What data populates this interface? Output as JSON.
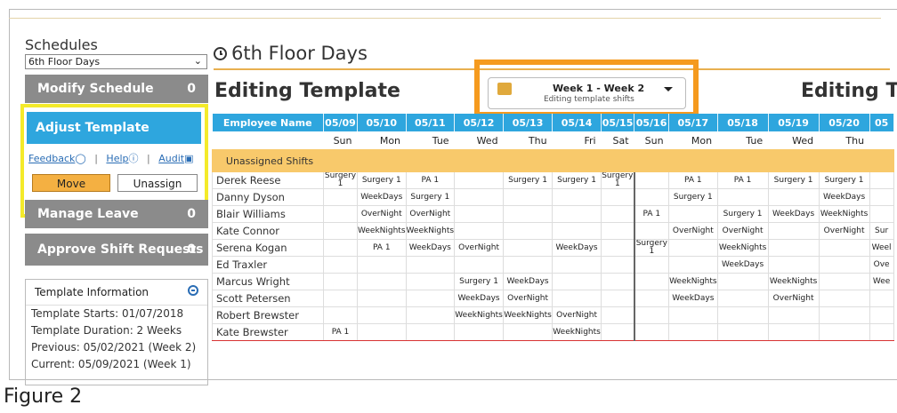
{
  "sidebar": {
    "title": "Schedules",
    "schedule_select": "6th Floor Days",
    "modify": {
      "label": "Modify Schedule",
      "count": "0"
    },
    "adjust": {
      "label": "Adjust Template"
    },
    "links": {
      "feedback": "Feedback",
      "help": "Help",
      "audit": "Audit"
    },
    "move_label": "Move",
    "unassign_label": "Unassign",
    "manage": {
      "label": "Manage Leave",
      "count": "0"
    },
    "approve": {
      "label": "Approve Shift Requests",
      "count": "0"
    },
    "info": {
      "title": "Template Information",
      "rows": [
        "Template Starts: 01/07/2018",
        "Template Duration: 2 Weeks",
        "Previous: 05/02/2021 (Week 2)",
        "Current: 05/09/2021 (Week 1)"
      ]
    }
  },
  "main": {
    "title": "6th Floor Days",
    "editing_left": "Editing Template",
    "editing_right": "Editing Te",
    "week_selector": {
      "label": "Week 1 - Week 2",
      "sub": "Editing template shifts"
    }
  },
  "grid": {
    "name_header": "Employee Name",
    "dates": [
      "05/09",
      "05/10",
      "05/11",
      "05/12",
      "05/13",
      "05/14",
      "05/15",
      "05/16",
      "05/17",
      "05/18",
      "05/19",
      "05/20",
      "05"
    ],
    "days": [
      "Sun",
      "Mon",
      "Tue",
      "Wed",
      "Thu",
      "Fri",
      "Sat",
      "Sun",
      "Mon",
      "Tue",
      "Wed",
      "Thu",
      ""
    ],
    "unassigned_label": "Unassigned Shifts",
    "rows": [
      {
        "name": "Derek Reese",
        "cells": [
          "Surgery 1",
          "Surgery 1",
          "PA 1",
          "",
          "Surgery 1",
          "Surgery 1",
          "Surgery 1",
          "",
          "PA 1",
          "PA 1",
          "Surgery 1",
          "Surgery 1",
          ""
        ]
      },
      {
        "name": "Danny Dyson",
        "cells": [
          "",
          "WeekDays",
          "Surgery 1",
          "",
          "",
          "",
          "",
          "",
          "Surgery 1",
          "",
          "",
          "WeekDays",
          ""
        ]
      },
      {
        "name": "Blair Williams",
        "cells": [
          "",
          "OverNight",
          "OverNight",
          "",
          "",
          "",
          "",
          "PA 1",
          "",
          "Surgery 1",
          "WeekDays",
          "WeekNights",
          ""
        ]
      },
      {
        "name": "Kate Connor",
        "cells": [
          "",
          "WeekNights",
          "WeekNights",
          "",
          "",
          "",
          "",
          "",
          "OverNight",
          "OverNight",
          "",
          "OverNight",
          "Sur"
        ]
      },
      {
        "name": "Serena Kogan",
        "cells": [
          "",
          "PA 1",
          "WeekDays",
          "OverNight",
          "",
          "WeekDays",
          "",
          "Surgery 1",
          "",
          "WeekNights",
          "",
          "",
          "Weel"
        ]
      },
      {
        "name": "Ed Traxler",
        "cells": [
          "",
          "",
          "",
          "",
          "",
          "",
          "",
          "",
          "",
          "WeekDays",
          "",
          "",
          "Ove"
        ]
      },
      {
        "name": "Marcus Wright",
        "cells": [
          "",
          "",
          "",
          "Surgery 1",
          "WeekDays",
          "",
          "",
          "",
          "WeekNights",
          "",
          "WeekNights",
          "",
          "Wee"
        ]
      },
      {
        "name": "Scott Petersen",
        "cells": [
          "",
          "",
          "",
          "WeekDays",
          "OverNight",
          "",
          "",
          "",
          "WeekDays",
          "",
          "OverNight",
          "",
          ""
        ]
      },
      {
        "name": "Robert Brewster",
        "cells": [
          "",
          "",
          "",
          "WeekNights",
          "WeekNights",
          "OverNight",
          "",
          "",
          "",
          "",
          "",
          "",
          ""
        ]
      },
      {
        "name": "Kate Brewster",
        "cells": [
          "PA 1",
          "",
          "",
          "",
          "",
          "WeekNights",
          "",
          "",
          "",
          "",
          "",
          "",
          ""
        ]
      }
    ]
  },
  "figure_caption": "Figure 2"
}
